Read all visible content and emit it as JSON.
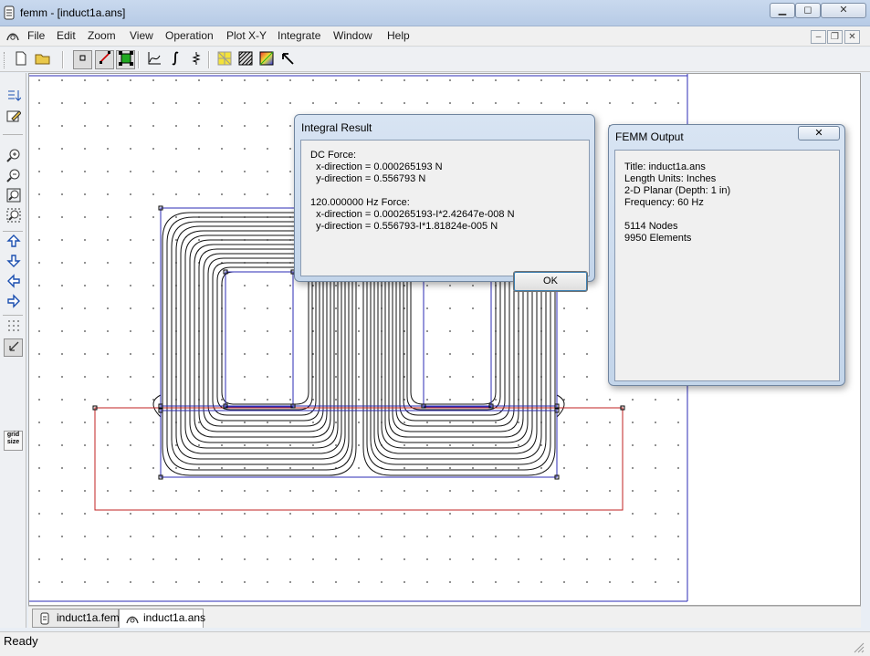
{
  "app": {
    "title": "femm - [induct1a.ans]"
  },
  "window_controls": {
    "minimize": "▁",
    "restore": "◻",
    "close": "✕"
  },
  "menu": [
    "File",
    "Edit",
    "Zoom",
    "View",
    "Operation",
    "Plot X-Y",
    "Integrate",
    "Window",
    "Help"
  ],
  "mdi_controls": {
    "minimize": "‒",
    "restore": "❐",
    "close": "✕"
  },
  "integral_dialog": {
    "title": "Integral Result",
    "lines": [
      "DC Force:",
      "  x-direction = 0.000265193 N",
      "  y-direction = 0.556793 N",
      "",
      "120.000000 Hz Force:",
      "  x-direction = 0.000265193-I*2.42647e-008 N",
      "  y-direction = 0.556793-I*1.81824e-005 N"
    ],
    "ok_label": "OK"
  },
  "output_panel": {
    "title": "FEMM Output",
    "close_label": "✕",
    "lines": [
      "Title: induct1a.ans",
      "Length Units: Inches",
      "2-D Planar (Depth: 1 in)",
      "Frequency: 60 Hz",
      "",
      "5114 Nodes",
      "9950 Elements"
    ]
  },
  "tabs": [
    {
      "label": "induct1a.fem",
      "icon": "femm-doc-icon"
    },
    {
      "label": "induct1a.ans",
      "icon": "femm-post-icon"
    }
  ],
  "grid_size_label": "grid size",
  "status": {
    "text": "Ready"
  },
  "colors": {
    "accent": "#1b4fb0",
    "boundary_blue": "#2b2bb5",
    "boundary_red": "#c02020"
  }
}
